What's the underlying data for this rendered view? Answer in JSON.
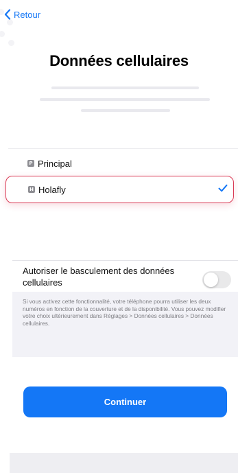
{
  "nav": {
    "back_label": "Retour",
    "back_icon": "chevron-left-icon"
  },
  "page": {
    "title": "Données cellulaires"
  },
  "sim_list": [
    {
      "badge": "P",
      "label": "Principal",
      "selected": false
    },
    {
      "badge": "H",
      "label": "Holafly",
      "selected": true
    }
  ],
  "data_switching": {
    "label": "Autoriser le basculement des données cellulaires",
    "enabled": false,
    "footnote": "Si vous activez cette fonctionnalité, votre téléphone pourra utiliser les deux numéros en fonction de la couverture et de la disponibilité. Vous pouvez modifier votre choix ultérieurement dans Réglages > Données cellulaires > Données cellulaires."
  },
  "actions": {
    "continue_label": "Continuer"
  },
  "colors": {
    "accent": "#1477f6",
    "selected_border": "#d93a55",
    "badge": "#8e8e93"
  }
}
